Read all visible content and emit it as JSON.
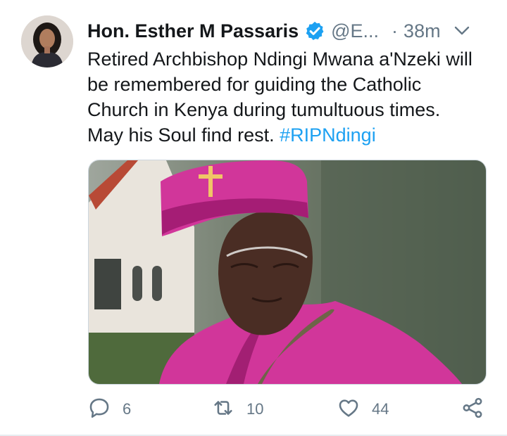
{
  "tweet": {
    "author_name": "Hon. Esther M Passaris",
    "handle": "@E...",
    "separator": "·",
    "time": "38m",
    "text_lines": [
      "Retired Archbishop Ndingi Mwana a'Nzeki will",
      "be remembered for guiding the Catholic",
      "Church in Kenya during tumultuous times.",
      "May his Soul find rest. "
    ],
    "hashtag": "#RIPNdingi",
    "media_description": "photo of archbishop in magenta vestments and zucchetto with gold cross",
    "actions": {
      "replies": "6",
      "retweets": "10",
      "likes": "44"
    }
  },
  "colors": {
    "link": "#1da1f2",
    "verified": "#1da1f2",
    "secondary": "#657786",
    "magenta": "#d1369a"
  },
  "icons": [
    "verified-badge-icon",
    "chevron-down-icon",
    "reply-icon",
    "retweet-icon",
    "like-icon",
    "share-icon"
  ]
}
